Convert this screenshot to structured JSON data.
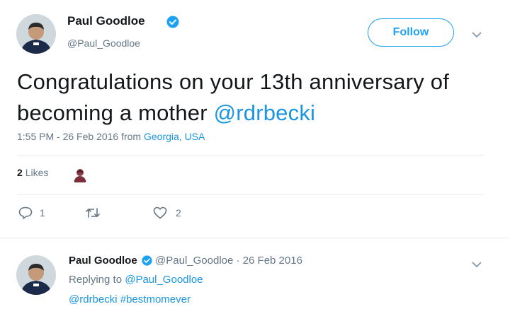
{
  "tweet": {
    "author_name": "Paul Goodloe",
    "author_handle": "@Paul_Goodloe",
    "follow_label": "Follow",
    "text_part1": "Congratulations on your 13th anniversary of becoming a mother ",
    "text_mention": "@rdrbecki",
    "time": "1:55 PM - 26 Feb 2016 from ",
    "location": "Georgia, USA",
    "likes_count": "2",
    "likes_label": "Likes",
    "reply_count": "1",
    "like_count": "2"
  },
  "reply": {
    "author_name": "Paul Goodloe",
    "author_handle": "@Paul_Goodloe",
    "separator": "·",
    "date": "26 Feb 2016",
    "replying_prefix": "Replying to ",
    "replying_handle": "@Paul_Goodloe",
    "text_mention": "@rdrbecki",
    "text_hashtag": "#bestmomever"
  },
  "colors": {
    "accent": "#1da1f2",
    "link": "#1b95e0",
    "muted": "#657786"
  },
  "icons": [
    "verified-badge-icon",
    "chevron-down-icon",
    "reply-icon",
    "retweet-icon",
    "heart-icon"
  ]
}
